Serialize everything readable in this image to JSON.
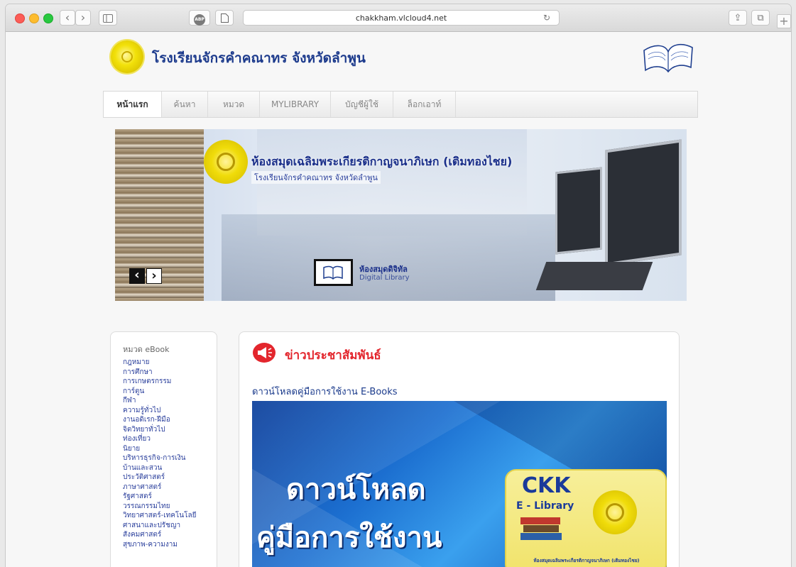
{
  "browser": {
    "url": "chakkham.vlcloud4.net",
    "adblock_label": "ABP",
    "back_glyph": "‹",
    "forward_glyph": "›",
    "reload_glyph": "↻",
    "share_glyph": "⇪",
    "tabs_glyph": "⧉",
    "new_tab_glyph": "+"
  },
  "site": {
    "title": "โรงเรียนจักรคำคณาทร จังหวัดลำพูน"
  },
  "nav": {
    "items": [
      {
        "label": "หน้าแรก"
      },
      {
        "label": "ค้นหา"
      },
      {
        "label": "หมวด"
      },
      {
        "label": "MYLIBRARY"
      },
      {
        "label": "บัญชีผู้ใช้"
      },
      {
        "label": "ล็อกเอาท์"
      }
    ]
  },
  "banner": {
    "headline": "ห้องสมุดเฉลิมพระเกียรติกาญจนาภิเษก (เติมทองไชย)",
    "subheadline": "โรงเรียนจักรคำคณาทร จังหวัดลำพูน",
    "digital_label": "ห้องสมุดดิจิทัล",
    "digital_sub": "Digital Library",
    "prev_glyph": "‹",
    "next_glyph": "›"
  },
  "sidebar": {
    "title": "หมวด eBook",
    "items": [
      "กฎหมาย",
      "การศึกษา",
      "การเกษตรกรรม",
      "การ์ตูน",
      "กีฬา",
      "ความรู้ทั่วไป",
      "งานอดิเรก-ฝีมือ",
      "จิตวิทยาทั่วไป",
      "ท่องเที่ยว",
      "นิยาย",
      "บริหารธุรกิจ-การเงิน",
      "บ้านและสวน",
      "ประวัติศาสตร์",
      "ภาษาศาสตร์",
      "รัฐศาสตร์",
      "วรรณกรรมไทย",
      "วิทยาศาสตร์-เทคโนโลยี",
      "ศาสนาและปรัชญา",
      "สังคมศาสตร์",
      "สุขภาพ-ความงาม"
    ]
  },
  "news": {
    "title": "ข่าวประชาสัมพันธ์",
    "post_title": "ดาวน์โหลดคู่มือการใช้งาน E-Books",
    "image_line1": "ดาวน์โหลด",
    "image_line2": "คู่มือการใช้งาน",
    "badge_ckk": "CKK",
    "badge_elib": "E - Library",
    "badge_caption": "ห้องสมุดเฉลิมพระเกียรติกาญจนาภิเษก (เติมทองไชย)"
  }
}
